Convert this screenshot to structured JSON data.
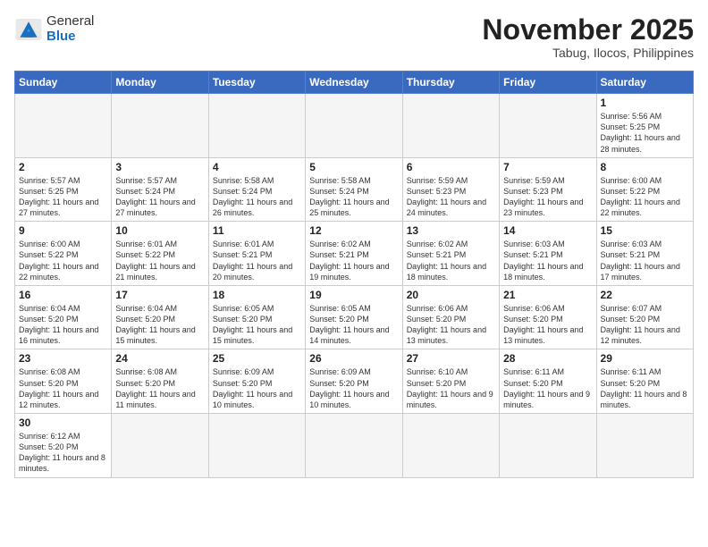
{
  "header": {
    "logo_general": "General",
    "logo_blue": "Blue",
    "month": "November 2025",
    "location": "Tabug, Ilocos, Philippines"
  },
  "weekdays": [
    "Sunday",
    "Monday",
    "Tuesday",
    "Wednesday",
    "Thursday",
    "Friday",
    "Saturday"
  ],
  "weeks": [
    [
      {
        "day": "",
        "empty": true
      },
      {
        "day": "",
        "empty": true
      },
      {
        "day": "",
        "empty": true
      },
      {
        "day": "",
        "empty": true
      },
      {
        "day": "",
        "empty": true
      },
      {
        "day": "",
        "empty": true
      },
      {
        "day": "1",
        "sunrise": "5:56 AM",
        "sunset": "5:25 PM",
        "daylight": "11 hours and 28 minutes."
      }
    ],
    [
      {
        "day": "2",
        "sunrise": "5:57 AM",
        "sunset": "5:25 PM",
        "daylight": "11 hours and 27 minutes."
      },
      {
        "day": "3",
        "sunrise": "5:57 AM",
        "sunset": "5:24 PM",
        "daylight": "11 hours and 27 minutes."
      },
      {
        "day": "4",
        "sunrise": "5:58 AM",
        "sunset": "5:24 PM",
        "daylight": "11 hours and 26 minutes."
      },
      {
        "day": "5",
        "sunrise": "5:58 AM",
        "sunset": "5:24 PM",
        "daylight": "11 hours and 25 minutes."
      },
      {
        "day": "6",
        "sunrise": "5:59 AM",
        "sunset": "5:23 PM",
        "daylight": "11 hours and 24 minutes."
      },
      {
        "day": "7",
        "sunrise": "5:59 AM",
        "sunset": "5:23 PM",
        "daylight": "11 hours and 23 minutes."
      },
      {
        "day": "8",
        "sunrise": "6:00 AM",
        "sunset": "5:22 PM",
        "daylight": "11 hours and 22 minutes."
      }
    ],
    [
      {
        "day": "9",
        "sunrise": "6:00 AM",
        "sunset": "5:22 PM",
        "daylight": "11 hours and 22 minutes."
      },
      {
        "day": "10",
        "sunrise": "6:01 AM",
        "sunset": "5:22 PM",
        "daylight": "11 hours and 21 minutes."
      },
      {
        "day": "11",
        "sunrise": "6:01 AM",
        "sunset": "5:21 PM",
        "daylight": "11 hours and 20 minutes."
      },
      {
        "day": "12",
        "sunrise": "6:02 AM",
        "sunset": "5:21 PM",
        "daylight": "11 hours and 19 minutes."
      },
      {
        "day": "13",
        "sunrise": "6:02 AM",
        "sunset": "5:21 PM",
        "daylight": "11 hours and 18 minutes."
      },
      {
        "day": "14",
        "sunrise": "6:03 AM",
        "sunset": "5:21 PM",
        "daylight": "11 hours and 18 minutes."
      },
      {
        "day": "15",
        "sunrise": "6:03 AM",
        "sunset": "5:21 PM",
        "daylight": "11 hours and 17 minutes."
      }
    ],
    [
      {
        "day": "16",
        "sunrise": "6:04 AM",
        "sunset": "5:20 PM",
        "daylight": "11 hours and 16 minutes."
      },
      {
        "day": "17",
        "sunrise": "6:04 AM",
        "sunset": "5:20 PM",
        "daylight": "11 hours and 15 minutes."
      },
      {
        "day": "18",
        "sunrise": "6:05 AM",
        "sunset": "5:20 PM",
        "daylight": "11 hours and 15 minutes."
      },
      {
        "day": "19",
        "sunrise": "6:05 AM",
        "sunset": "5:20 PM",
        "daylight": "11 hours and 14 minutes."
      },
      {
        "day": "20",
        "sunrise": "6:06 AM",
        "sunset": "5:20 PM",
        "daylight": "11 hours and 13 minutes."
      },
      {
        "day": "21",
        "sunrise": "6:06 AM",
        "sunset": "5:20 PM",
        "daylight": "11 hours and 13 minutes."
      },
      {
        "day": "22",
        "sunrise": "6:07 AM",
        "sunset": "5:20 PM",
        "daylight": "11 hours and 12 minutes."
      }
    ],
    [
      {
        "day": "23",
        "sunrise": "6:08 AM",
        "sunset": "5:20 PM",
        "daylight": "11 hours and 12 minutes."
      },
      {
        "day": "24",
        "sunrise": "6:08 AM",
        "sunset": "5:20 PM",
        "daylight": "11 hours and 11 minutes."
      },
      {
        "day": "25",
        "sunrise": "6:09 AM",
        "sunset": "5:20 PM",
        "daylight": "11 hours and 10 minutes."
      },
      {
        "day": "26",
        "sunrise": "6:09 AM",
        "sunset": "5:20 PM",
        "daylight": "11 hours and 10 minutes."
      },
      {
        "day": "27",
        "sunrise": "6:10 AM",
        "sunset": "5:20 PM",
        "daylight": "11 hours and 9 minutes."
      },
      {
        "day": "28",
        "sunrise": "6:11 AM",
        "sunset": "5:20 PM",
        "daylight": "11 hours and 9 minutes."
      },
      {
        "day": "29",
        "sunrise": "6:11 AM",
        "sunset": "5:20 PM",
        "daylight": "11 hours and 8 minutes."
      }
    ],
    [
      {
        "day": "30",
        "sunrise": "6:12 AM",
        "sunset": "5:20 PM",
        "daylight": "11 hours and 8 minutes."
      },
      {
        "day": "",
        "empty": true
      },
      {
        "day": "",
        "empty": true
      },
      {
        "day": "",
        "empty": true
      },
      {
        "day": "",
        "empty": true
      },
      {
        "day": "",
        "empty": true
      },
      {
        "day": "",
        "empty": true
      }
    ]
  ]
}
